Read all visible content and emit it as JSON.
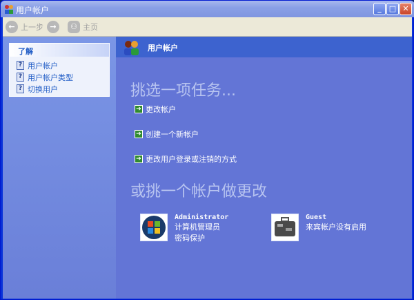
{
  "window": {
    "title": "用户帐户"
  },
  "toolbar": {
    "back": "上一步",
    "home": "主页"
  },
  "sidebar": {
    "header": "了解",
    "items": [
      {
        "label": "用户帐户"
      },
      {
        "label": "用户帐户类型"
      },
      {
        "label": "切换用户"
      }
    ]
  },
  "main": {
    "banner": "用户帐户",
    "heading1": "挑选一项任务...",
    "tasks": [
      {
        "label": "更改帐户"
      },
      {
        "label": "创建一个新帐户"
      },
      {
        "label": "更改用户登录或注销的方式"
      }
    ],
    "heading2": "或挑一个帐户做更改",
    "accounts": [
      {
        "name": "Administrator",
        "line1": "计算机管理员",
        "line2": "密码保护"
      },
      {
        "name": "Guest",
        "line1": "来宾帐户没有启用"
      }
    ]
  }
}
